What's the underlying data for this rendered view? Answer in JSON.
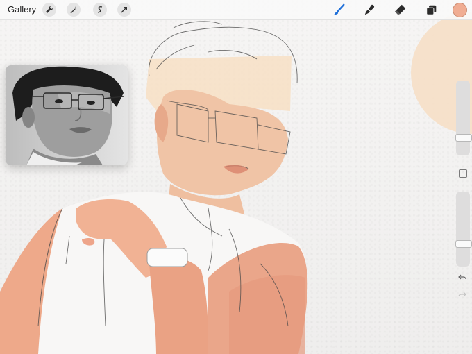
{
  "toolbar": {
    "gallery_label": "Gallery",
    "left_tools": [
      "wrench-icon",
      "magic-wand-icon",
      "selection-icon",
      "transform-arrow-icon"
    ],
    "right_tools": [
      "brush-icon",
      "smudge-icon",
      "eraser-icon",
      "layers-icon"
    ],
    "active_tool": "brush",
    "active_tool_color": "#1e6fd9",
    "current_color": "#f0ad93"
  },
  "sidebar": {
    "brush_size_level": 0.22,
    "opacity_level": 0.71,
    "undo_icon": "undo-icon",
    "redo_icon": "redo-icon"
  },
  "reference": {
    "kind": "grayscale reference photo"
  }
}
